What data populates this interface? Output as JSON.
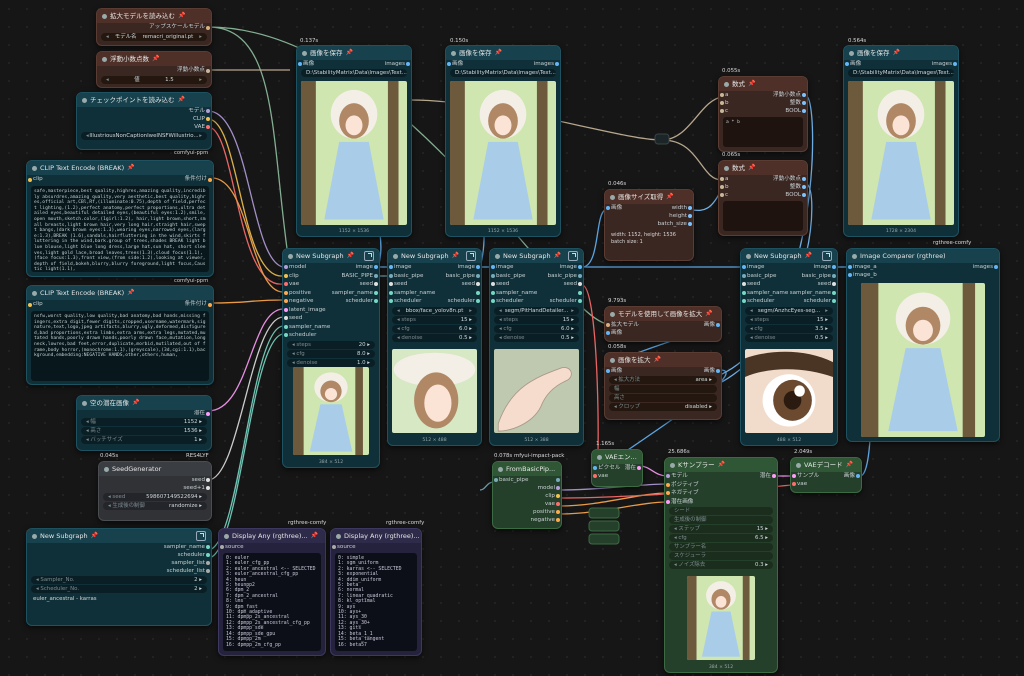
{
  "colors": {
    "model": "#b39ddb",
    "clip": "#f2c14e",
    "vae": "#ff6e6e",
    "positive": "#ffa94d",
    "image": "#64b5f6",
    "latent": "#ff9cf9",
    "sampler": "#76d7c4",
    "number": "#7cc2ff",
    "seed": "#e0e0e0"
  },
  "upscale_loader": {
    "title": "拡大モデルを読み込む",
    "out": "アップスケールモデル",
    "widget_label": "モデル名",
    "widget_value": "remacri_original.pt"
  },
  "float_node": {
    "title": "浮動小数点数",
    "out": "浮動小数点",
    "widget_label": "値",
    "widget_value": "1.5"
  },
  "ckpt_loader": {
    "title": "チェックポイントを読み込む",
    "outs": [
      "モデル",
      "CLIP",
      "VAE"
    ],
    "widget_value": "IllustriousNonCaptionIweINSFWillustrio...",
    "footer": "comfyui-ppm"
  },
  "clip_pos": {
    "title": "CLIP Text Encode (BREAK)",
    "in": "clip",
    "out": "条件付け",
    "text": "safe,masterpiece,best quality,highres,amazing quality,incredibly absurdres,amazing quality,very aesthetic,best quality,highres,official art,CBl,Rf,(illuminate:0.75),depth of field,perfect lighting,(1.2),perfect anatomy,perfect proportions,ultra detailed eyes,beautiful detailed eyes,(beautiful eyes:1.2),smile,open mouth,sketch.color,(1girl:1.2), hair,light brown,short,small breasts,light brown hair,very long hair,straight hair,swept bangs,(dark brown eyes:1.3),wearing eyes,narrowed eyes,(large:1.3),BREAK (1.6),sandals,hairfluttering in the wind,skirts fluttering in the wind,bark.group of trees,shades BREAK light blue blouse,light blue long dress,large hat,sun hat, short sleeves,light gold lace,broad leaves,trees(1.3),cloud focus(1.1), (face focus:1.3),front view,(from side:1.2),looking at viewer,depth of field,bokeh,blurry,blurry foreground,light focus,Caustic light(1.1),",
    "footer": "comfyui-ppm"
  },
  "clip_neg": {
    "title": "CLIP Text Encode (BREAK)",
    "in": "clip",
    "out": "条件付け",
    "text": "nsfw,worst quality,low quality,bad anatomy,bad hands,missing fingers,extra digit,fewer digits,cropped,username,watermark,signature,text,logo,jpeg artifacts,blurry,ugly,deformed,disfigured,bad proportions,extra limbs,extra arms,extra legs,mutated,mutated hands,poorly drawn hands,poorly drawn face,mutation,long neck,lowres,bad feet,error,duplicate,morbid,mutilated,out of frame,body horror,(monochrome:1.1),(greyscale),(3d,cgi:1.1),background,embedding:NEGATIVE HANDS,other,others,human,"
  },
  "empty_latent": {
    "title": "空の潜在画像",
    "out": "潜在",
    "w_label": "幅",
    "w_value": "1152",
    "h_label": "高さ",
    "h_value": "1536",
    "b_label": "バッチサイズ",
    "b_value": "1"
  },
  "seed_gen": {
    "time": "0.045s",
    "title": "SeedGenerator",
    "badge": "RES4LYF",
    "outs": [
      "seed",
      "seed+1"
    ],
    "seed_label": "seed",
    "seed_value": "598607149522694",
    "ctrl_label": "生成後の制御",
    "ctrl_value": "randomize"
  },
  "subgraph_small": {
    "title": "New Subgraph",
    "outs": [
      "sampler_name",
      "scheduler",
      "sampler_list",
      "scheduler_list"
    ],
    "s_label": "Sampler_No.",
    "s_value": "2",
    "sc_label": "Scheduler_No.",
    "sc_value": "2",
    "text": "euler_ancestral - karras"
  },
  "display1": {
    "badge": "rgthree-comfy",
    "title": "Display Any (rgthree)...",
    "in": "source",
    "list": "0: euler\n1: euler_cfg_pp\n2: euler_ancestral <-- SELECTED\n3: euler_ancestral_cfg_pp\n4: heun\n5: heunpp2\n6: dpm_2\n7: dpm_2_ancestral\n8: lms\n9: dpm_fast\n10: dpm_adaptive\n11: dpmpp_2s_ancestral\n12: dpmpp_2s_ancestral_cfg_pp\n13: dpmpp_sde\n14: dpmpp_sde_gpu\n15: dpmpp_2m\n16: dpmpp_2m_cfg_pp"
  },
  "display2": {
    "badge": "rgthree-comfy",
    "title": "Display Any (rgthree)...",
    "in": "source",
    "list": "0: simple\n1: sgm_uniform\n2: karras <-- SELECTED\n3: exponential\n4: ddim_uniform\n5: beta\n6: normal\n7: linear_quadratic\n8: kl_optimal\n9: ays\n10: ays+\n11: ays_30\n12: ays_30+\n13: gits\n14: beta_1_1\n15: beta_tangent\n16: beta57"
  },
  "save1": {
    "time": "0.137s",
    "title": "画像を保存",
    "in": "画像",
    "out": "images",
    "path": "D:\\StabilityMatrix\\Data\\Images\\Text...",
    "cap": "1152 × 1536"
  },
  "save2": {
    "time": "0.150s",
    "title": "画像を保存",
    "in": "画像",
    "out": "images",
    "path": "D:\\StabilityMatrix\\Data\\Images\\Text...",
    "cap": "1152 × 1536"
  },
  "save3": {
    "time": "0.564s",
    "title": "画像を保存",
    "in": "画像",
    "out": "images",
    "path": "D:\\StabilityMatrix\\Data\\Images\\Text...",
    "cap": "1728 × 2304"
  },
  "math1": {
    "time": "0.055s",
    "title": "数式",
    "ins": [
      "a",
      "b",
      "c"
    ],
    "outs": [
      "浮動小数点",
      "整数",
      "BOOL"
    ],
    "expr": "a * b"
  },
  "math2": {
    "time": "0.065s",
    "title": "数式",
    "ins": [
      "a",
      "b",
      "c"
    ],
    "outs": [
      "浮動小数点",
      "整数",
      "BOOL"
    ]
  },
  "imgsize": {
    "time": "0.046s",
    "title": "画像サイズ取得",
    "in": "画像",
    "outs": [
      "width",
      "height",
      "batch_size"
    ],
    "info1": "width: 1152, height: 1536",
    "info2": "batch size: 1"
  },
  "upscale_model": {
    "time": "9.793s",
    "title": "モデルを使用して画像を拡大",
    "ins": [
      "拡大モデル",
      "画像"
    ],
    "out": "画像"
  },
  "upscale": {
    "time": "0.058s",
    "title": "画像を拡大",
    "in": "画像",
    "out": "画像",
    "method_label": "拡大方法",
    "method_value": "area",
    "w_label": "幅",
    "h_label": "高さ",
    "crop_label": "クロップ",
    "crop_value": "disabled"
  },
  "sg1": {
    "title": "New Subgraph",
    "ins": [
      "model",
      "clip",
      "vae",
      "positive",
      "negative",
      "latent_image",
      "seed",
      "sampler_name",
      "scheduler"
    ],
    "outs": [
      "image",
      "BASIC_PIPE",
      "seed",
      "sampler_name",
      "scheduler"
    ],
    "steps_label": "steps",
    "steps": "20",
    "cfg_label": "cfg",
    "cfg": "8.0",
    "den_label": "denoise",
    "den": "1.0",
    "cap": "384 × 512"
  },
  "sg2": {
    "title": "New Subgraph",
    "ins": [
      "image",
      "basic_pipe",
      "seed",
      "sampler_name",
      "scheduler"
    ],
    "outs": [
      "image",
      "basic_pipe",
      "seed",
      "sampler_name",
      "scheduler"
    ],
    "det": "bbox/face_yolov8n.pt",
    "steps_label": "steps",
    "steps": "15",
    "cfg_label": "cfg",
    "cfg": "6.0",
    "den_label": "denoise",
    "den": "0.5",
    "cap": "512 × 488"
  },
  "sg3": {
    "title": "New Subgraph",
    "ins": [
      "image",
      "basic_pipe",
      "seed",
      "sampler_name",
      "scheduler"
    ],
    "outs": [
      "image",
      "basic_pipe",
      "seed",
      "sampler_name",
      "scheduler"
    ],
    "det": "segm/PitHandDetailer...",
    "steps_label": "steps",
    "steps": "15",
    "cfg_label": "cfg",
    "cfg": "6.0",
    "den_label": "denoise",
    "den": "0.5",
    "cap": "512 × 388"
  },
  "sg4": {
    "title": "New Subgraph",
    "ins": [
      "image",
      "basic_pipe",
      "seed",
      "sampler_name",
      "scheduler"
    ],
    "outs": [
      "image",
      "basic_pipe",
      "seed",
      "sampler_name",
      "scheduler"
    ],
    "det": "segm/AnzhcEyes-seg...",
    "steps_label": "steps",
    "steps": "15",
    "cfg_label": "cfg",
    "cfg": "3.5",
    "den_label": "denoise",
    "den": "0.5",
    "cap": "488 × 512"
  },
  "comparer": {
    "badge": "rgthree-comfy",
    "title": "Image Comparer (rgthree)",
    "ins": [
      "image_a",
      "image_b"
    ],
    "out": "images"
  },
  "frombasic": {
    "time": "0.078s",
    "badge": "mfyui-impact-pack",
    "title": "FromBasicPip...",
    "in": "basic_pipe",
    "outs": [
      "basic_pipe",
      "model",
      "clip",
      "vae",
      "positive",
      "negative"
    ]
  },
  "vaeenc": {
    "time": "1.165s",
    "title": "VAEエン...",
    "ins": [
      "ピクセル",
      "vae"
    ],
    "out": "潜在"
  },
  "ksampler": {
    "time": "25.686s",
    "title": "Kサンプラー",
    "ins": [
      "モデル",
      "ポジティブ",
      "ネガティブ",
      "潜在画像"
    ],
    "out": "潜在",
    "seed_label": "シード",
    "ctrl_label": "生成後の制御",
    "steps_label": "ステップ",
    "steps": "15",
    "cfg_label": "cfg",
    "cfg": "6.5",
    "sampler_label": "サンプラー名",
    "sched_label": "スケジューラ",
    "den_label": "ノイズ除去",
    "den": "0.3",
    "cap": "384 × 512"
  },
  "vaedec": {
    "time": "2.049s",
    "title": "VAEデコード",
    "ins": [
      "サンプル",
      "vae"
    ],
    "out": "画像"
  }
}
